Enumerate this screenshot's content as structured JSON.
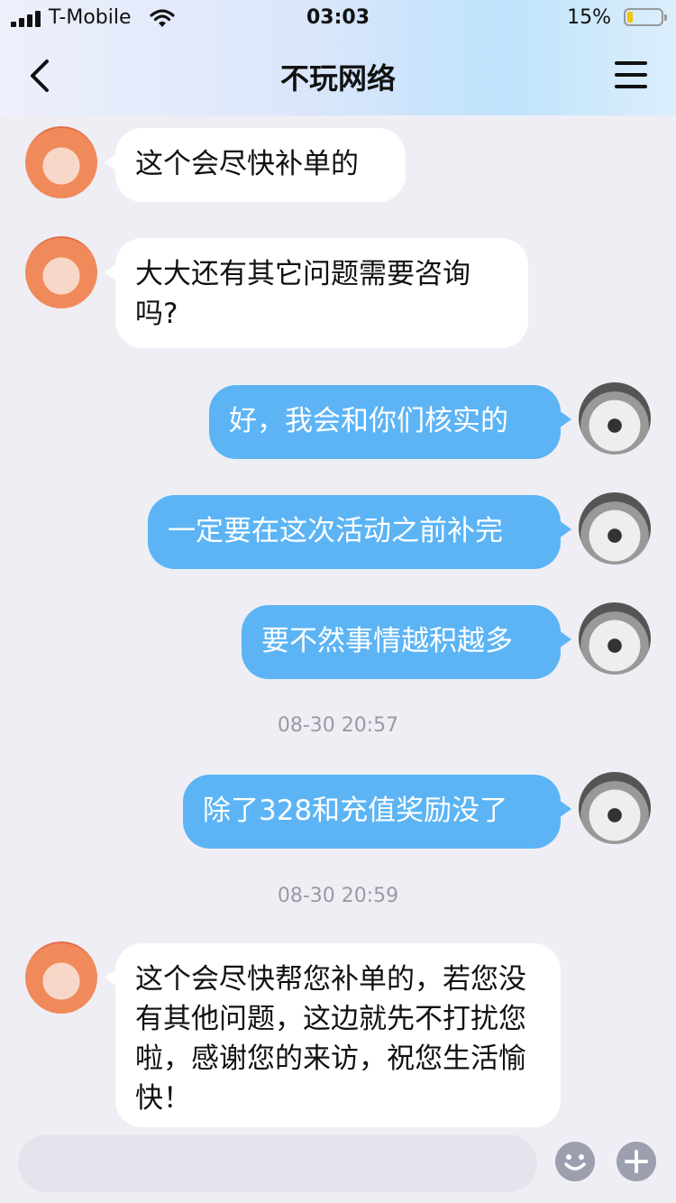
{
  "status_bar": {
    "carrier": "T-Mobile",
    "time": "03:03",
    "battery_percent": "15%"
  },
  "header": {
    "title": "不玩网络"
  },
  "messages": [
    {
      "sender": "agent",
      "text": "这个会尽快补单的"
    },
    {
      "sender": "agent",
      "text": "大大还有其它问题需要咨询吗?"
    },
    {
      "sender": "user",
      "text": "好，我会和你们核实的"
    },
    {
      "sender": "user",
      "text": "一定要在这次活动之前补完"
    },
    {
      "sender": "user",
      "text": "要不然事情越积越多"
    },
    {
      "type": "timestamp",
      "text": "08-30 20:57"
    },
    {
      "sender": "user",
      "text": "除了328和充值奖励没了"
    },
    {
      "type": "timestamp",
      "text": "08-30 20:59"
    },
    {
      "sender": "agent",
      "text": "这个会尽快帮您补单的，若您没有其他问题，这边就先不打扰您啦，感谢您的来访，祝您生活愉快！"
    }
  ],
  "icons": {
    "back": "chevron-left-icon",
    "menu": "hamburger-menu-icon",
    "emoji": "smiley-icon",
    "plus": "plus-icon"
  },
  "colors": {
    "outgoing_bubble": "#5cb4f5",
    "incoming_bubble": "#ffffff",
    "background": "#eeeef4"
  }
}
